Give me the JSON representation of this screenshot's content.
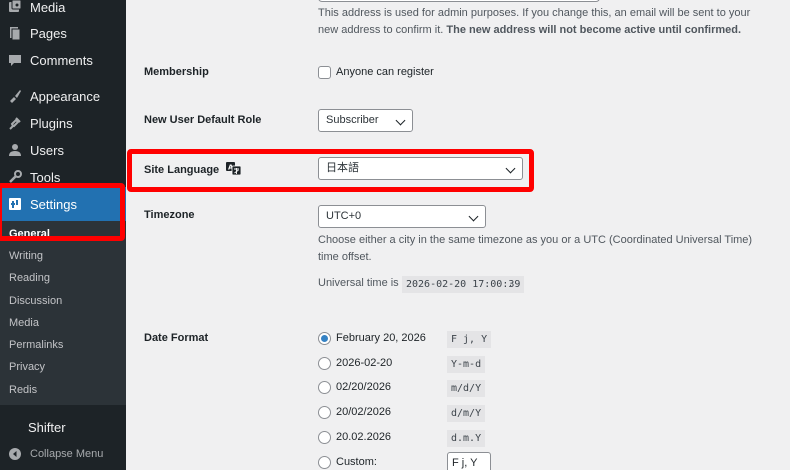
{
  "sidebar": {
    "menu": [
      {
        "label": "Media",
        "icon": "media-icon"
      },
      {
        "label": "Pages",
        "icon": "pages-icon"
      },
      {
        "label": "Comments",
        "icon": "comments-icon"
      },
      {
        "label": "Appearance",
        "icon": "appearance-icon"
      },
      {
        "label": "Plugins",
        "icon": "plugins-icon"
      },
      {
        "label": "Users",
        "icon": "users-icon"
      },
      {
        "label": "Tools",
        "icon": "tools-icon"
      },
      {
        "label": "Settings",
        "icon": "settings-icon"
      }
    ],
    "submenu": [
      "General",
      "Writing",
      "Reading",
      "Discussion",
      "Media",
      "Permalinks",
      "Privacy",
      "Redis"
    ],
    "shifter": "Shifter",
    "collapse": "Collapse Menu"
  },
  "email": {
    "description_1": "This address is used for admin purposes. If you change this, an email will be sent to your new address to confirm it.",
    "description_bold": "The new address will not become active until confirmed."
  },
  "membership": {
    "label": "Membership",
    "checkbox_label": "Anyone can register",
    "checked": false
  },
  "default_role": {
    "label": "New User Default Role",
    "value": "Subscriber"
  },
  "site_language": {
    "label": "Site Language",
    "value": "日本語"
  },
  "timezone": {
    "label": "Timezone",
    "value": "UTC+0",
    "description": "Choose either a city in the same timezone as you or a UTC (Coordinated Universal Time) time offset.",
    "universal_label": "Universal time is",
    "universal_value": "2026-02-20 17:00:39",
    "universal_suffix": "."
  },
  "date_format": {
    "label": "Date Format",
    "options": [
      {
        "label": "February 20, 2026",
        "code": "F j, Y",
        "checked": true
      },
      {
        "label": "2026-02-20",
        "code": "Y-m-d",
        "checked": false
      },
      {
        "label": "02/20/2026",
        "code": "m/d/Y",
        "checked": false
      },
      {
        "label": "20/02/2026",
        "code": "d/m/Y",
        "checked": false
      },
      {
        "label": "20.02.2026",
        "code": "d.m.Y",
        "checked": false
      },
      {
        "label": "Custom:",
        "code": "F j, Y",
        "checked": false
      }
    ]
  },
  "colors": {
    "sidebar": "#1d2327",
    "accent": "#2271b1",
    "highlight": "#ff0000"
  }
}
